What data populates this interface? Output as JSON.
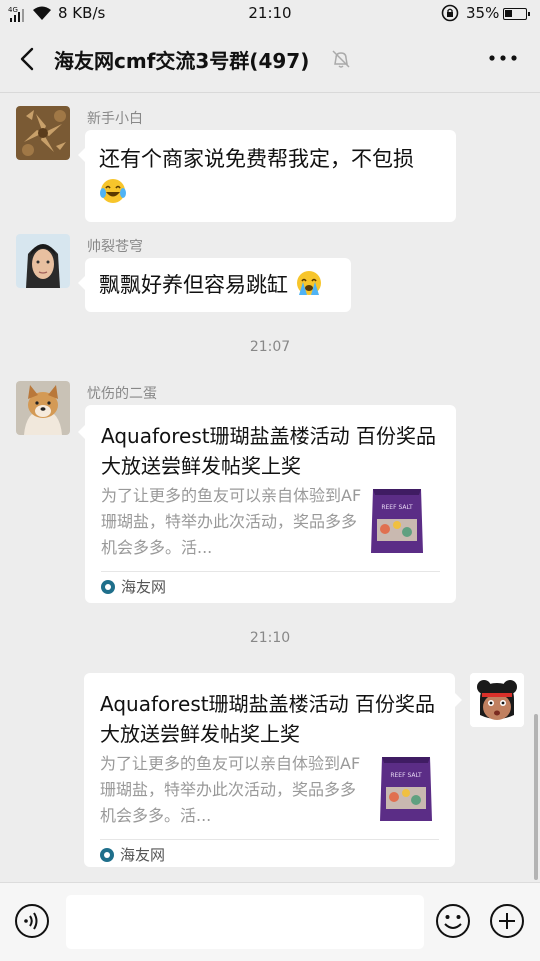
{
  "status_bar": {
    "network_label": "4G",
    "speed": "8 KB/s",
    "time": "21:10",
    "battery": "35%",
    "battery_level": 0.35
  },
  "header": {
    "title": "海友网cmf交流3号群(497)"
  },
  "messages": [
    {
      "sender": "新手小白",
      "text": "还有个商家说免费帮我定，不包损",
      "emoji": "face-with-tears-of-joy"
    },
    {
      "sender": "帅裂苍穹",
      "text": "飘飘好养但容易跳缸",
      "emoji": "loudly-crying-face"
    }
  ],
  "timestamps": [
    "21:07",
    "21:10"
  ],
  "link_cards": [
    {
      "sender": "忧伤的二蛋",
      "title": "Aquaforest珊瑚盐盖楼活动 百份奖品大放送尝鲜发帖奖上奖",
      "description": "为了让更多的鱼友可以亲自体验到AF珊瑚盐，特举办此次活动，奖品多多机会多多。活...",
      "source": "海友网",
      "thumb_label": "REEF SALT"
    },
    {
      "sender": "",
      "title": "Aquaforest珊瑚盐盖楼活动 百份奖品大放送尝鲜发帖奖上奖",
      "description": "为了让更多的鱼友可以亲自体验到AF珊瑚盐，特举办此次活动，奖品多多机会多多。活...",
      "source": "海友网",
      "thumb_label": "REEF SALT"
    }
  ],
  "colors": {
    "background": "#ededed",
    "bubble": "#ffffff",
    "meta_text": "#888888",
    "source_icon": "#1f6f8b",
    "thumb_purple": "#5b2d86"
  }
}
